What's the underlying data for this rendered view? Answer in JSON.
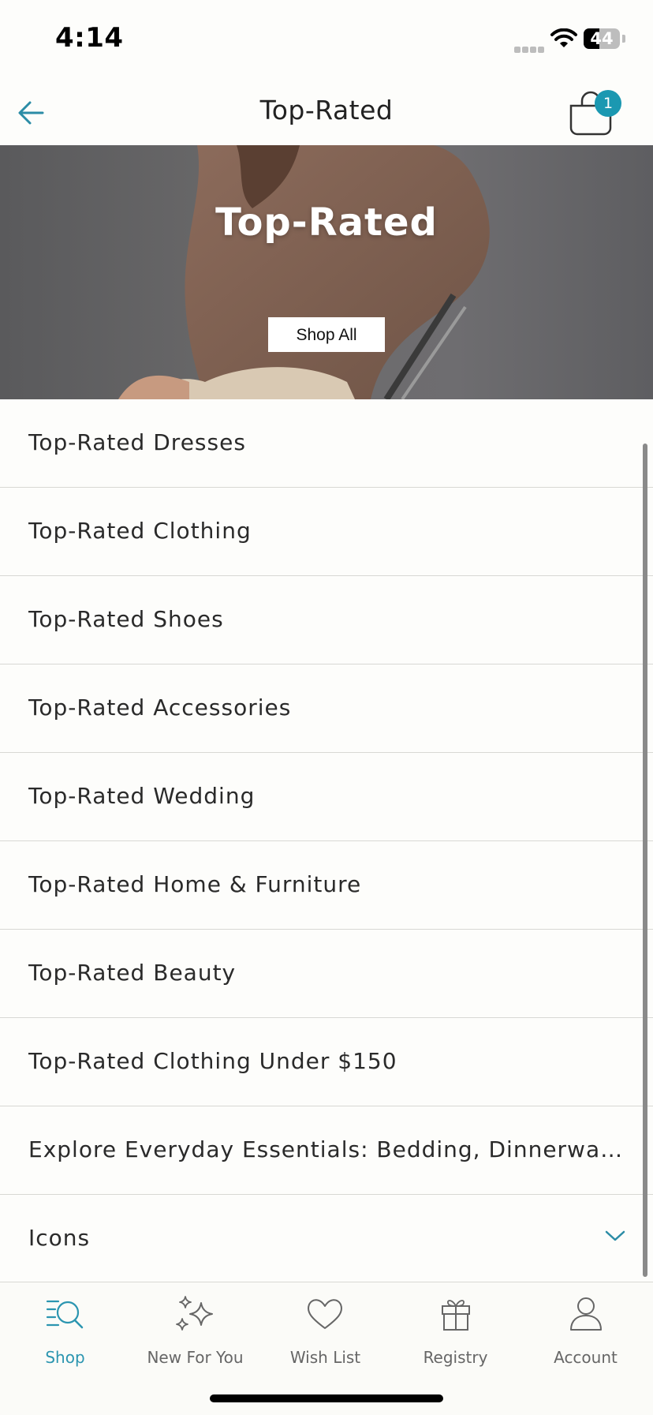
{
  "status_bar": {
    "time": "4:14",
    "battery": "44",
    "battery_fraction": 0.44
  },
  "header": {
    "title": "Top-Rated",
    "cart_count": "1"
  },
  "hero": {
    "title": "Top-Rated",
    "button_label": "Shop All"
  },
  "list": {
    "items": [
      {
        "label": "Top-Rated Dresses"
      },
      {
        "label": "Top-Rated Clothing"
      },
      {
        "label": "Top-Rated Shoes"
      },
      {
        "label": "Top-Rated Accessories"
      },
      {
        "label": "Top-Rated Wedding"
      },
      {
        "label": "Top-Rated Home & Furniture"
      },
      {
        "label": "Top-Rated Beauty"
      },
      {
        "label": "Top-Rated Clothing Under $150"
      },
      {
        "label": "Explore Everyday Essentials: Bedding, Dinnerware & Home Decor"
      },
      {
        "label": "Icons",
        "expandable": true
      }
    ]
  },
  "tabbar": {
    "tabs": [
      {
        "label": "Shop",
        "icon": "shop-search-icon",
        "active": true
      },
      {
        "label": "New For You",
        "icon": "sparkles-icon",
        "active": false
      },
      {
        "label": "Wish List",
        "icon": "heart-icon",
        "active": false
      },
      {
        "label": "Registry",
        "icon": "gift-icon",
        "active": false
      },
      {
        "label": "Account",
        "icon": "person-icon",
        "active": false
      }
    ]
  },
  "colors": {
    "accent": "#1b98b1",
    "background": "#fdfdfb",
    "divider": "#d8d8d4"
  }
}
